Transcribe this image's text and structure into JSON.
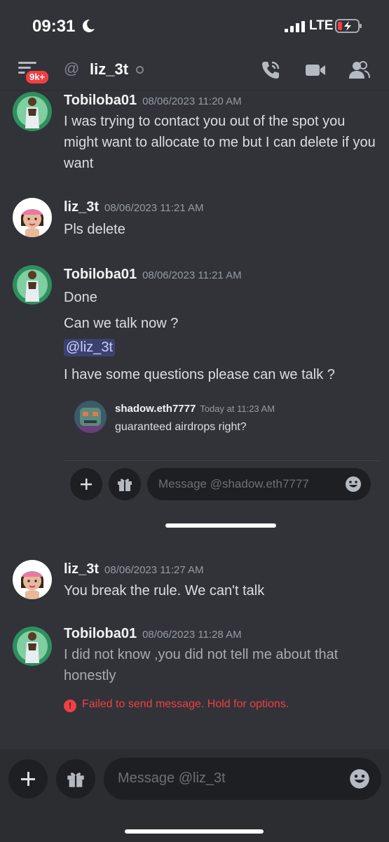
{
  "status_bar": {
    "time": "09:31",
    "network": "LTE"
  },
  "header": {
    "unread_badge": "9k+",
    "at_symbol": "@",
    "channel_name": "liz_3t"
  },
  "messages": [
    {
      "author": "Tobiloba01",
      "timestamp": "08/06/2023 11:20 AM",
      "lines": [
        "I was trying to contact you out of the spot you might want to allocate to me but I can delete if you want"
      ]
    },
    {
      "author": "liz_3t",
      "timestamp": "08/06/2023 11:21 AM",
      "lines": [
        "Pls delete"
      ]
    },
    {
      "author": "Tobiloba01",
      "timestamp": "08/06/2023 11:21 AM",
      "lines": [
        "Done",
        "Can we talk now ?",
        "@liz_3t",
        "I have some questions please can we talk ?"
      ]
    },
    {
      "author": "liz_3t",
      "timestamp": "08/06/2023 11:27 AM",
      "lines": [
        "You break the rule. We can't talk"
      ]
    },
    {
      "author": "Tobiloba01",
      "timestamp": "08/06/2023 11:28 AM",
      "lines": [
        "I did not know ,you did not tell me about that honestly"
      ]
    }
  ],
  "embedded_screenshot": {
    "author": "shadow.eth7777",
    "timestamp": "Today at 11:23 AM",
    "text": "guaranteed airdrops right?",
    "placeholder": "Message @shadow.eth7777"
  },
  "error": {
    "icon": "!",
    "text": "Failed to send message. Hold for options."
  },
  "composer": {
    "placeholder": "Message @liz_3t"
  },
  "colors": {
    "background": "#313338",
    "error": "#f23f43",
    "mention_bg": "#3c4270"
  }
}
